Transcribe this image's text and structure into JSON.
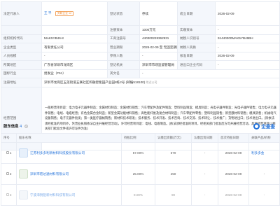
{
  "info": {
    "legal_rep_label": "法定代表人",
    "legal_rep_name": "王 平",
    "legal_rep_badge": "关联企业 12",
    "reg_status_label": "登记状态",
    "reg_status_value": "存续",
    "established_label": "成立日期",
    "established_value": "2026-02-09",
    "reg_capital_label": "注册资本",
    "reg_capital_value": "1000万元",
    "paid_capital_label": "实缴资本",
    "paid_capital_value": "-",
    "org_code_label": "组织机构代码",
    "org_code_value": "MAK5YB46-8",
    "biz_reg_no_label": "工商注册号",
    "biz_reg_no_value": "440300228362931",
    "taxpayer_id_label": "纳税人识别号",
    "taxpayer_id_value": "91440300MAK5YB46BH",
    "company_type_label": "企业类型",
    "company_type_value": "有限责任公司",
    "biz_term_label": "营业期限",
    "biz_term_value": "2026-02-09 至 无固定期限",
    "taxpayer_qual_label": "纳税人资质",
    "taxpayer_qual_value": "-",
    "staff_size_label": "人员规模",
    "staff_size_value": "-",
    "insured_label": "参保人数",
    "insured_value": "-",
    "approval_date_label": "核准日期",
    "approval_date_value": "2026-02-09",
    "region_label": "所属地区",
    "region_value": "广东省深圳市龙岗区",
    "reg_authority_label": "登记机关",
    "reg_authority_value": "深圳市市场监督管理局",
    "import_export_label": "进出口企业代码",
    "import_export_value": "-",
    "industry_label": "国标行业",
    "industry_value": "批发业（F51）",
    "en_name_label": "英文名",
    "en_name_value": "-",
    "reg_addr_label": "注册地址",
    "reg_addr_value": "深圳市龙岗区五菜街道五联社区和融智能园产业园8栋2号 (邮编518100)",
    "reg_addr_hint": "附近公司",
    "scope_label": "经营范围",
    "scope_value": "一般经营项目是：电力电子元器件制造；金属材料制造；金属材料销售；汽车零配件及配件制造；塑料制品制造；模具制造；光电子器件制造；光电子器件销售；电力电子元器件销售；电线、电缆经营；有色金属合金制造；新型金属功能材料销售；高性能纤维及复合材料制造；汽车零配件零售；塑料制品销售；新型膜材料销售；模具销售；机械电气设备销售；电子元器件批发；第一类医疗器械销售；新材料技术研发；技术服务、技术开发、技术咨询、技术交流、技术转让、技术推广；货物进出口；技术进出口。(除依法须经批准的项目外，凭营业执照依法自主开展经营活动)，许可经营项目是：电线、电缆制造。(依法须经批准的项目，经相关部门批准后方可开展经营活动，具体经营项目以相关部门批准文件或许可证件为准)"
  },
  "shareholders": {
    "title": "股东信息",
    "count": "4",
    "help": "?",
    "brand_name": "企查查",
    "columns": [
      "序号",
      "股东名称",
      "持股比例",
      "认缴出资额(万元)",
      "认缴出资日期",
      "首次持股日期",
      "关联产品/机构"
    ],
    "rows": [
      {
        "index": "1",
        "name": "江苏利多多利新材料科技股份有限公司",
        "ratio": "57.00%",
        "amount": "570",
        "sub_date": "-",
        "first_date": "2026-02-09",
        "related": "利多多金",
        "logo_color": "#e7f0fb"
      },
      {
        "index": "2",
        "name": "深圳市宏达通材料有限公司",
        "ratio": "25.00%",
        "amount": "250",
        "sub_date": "-",
        "first_date": "2026-02-09",
        "related": "-",
        "logo_color": "#edf3ea"
      },
      {
        "index": "3",
        "name": "宁波海锐铝新材料科技有限公司",
        "ratio": "9.00%",
        "amount": "90",
        "sub_date": "-",
        "first_date": "2026-02-09",
        "related": "-",
        "logo_color": "#eef3f8"
      }
    ]
  }
}
